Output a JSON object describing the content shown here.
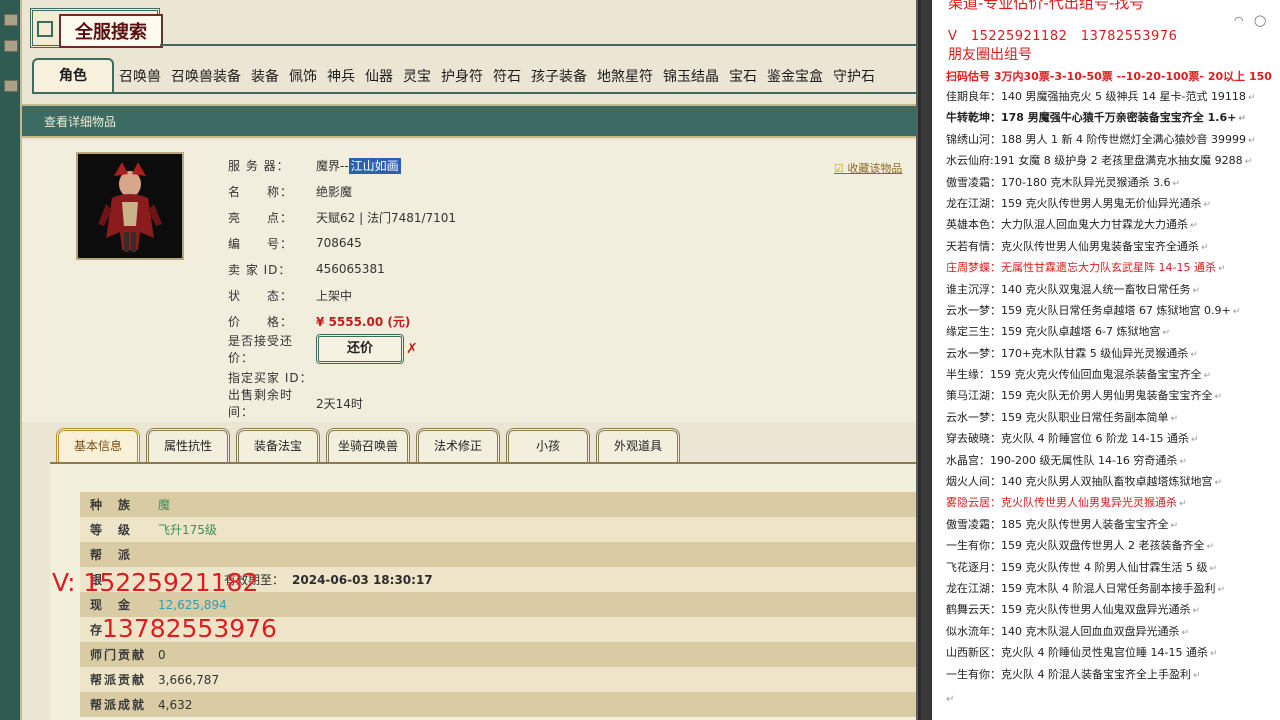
{
  "window": {
    "title": "全服搜索"
  },
  "categories": [
    "角色",
    "召唤兽",
    "召唤兽装备",
    "装备",
    "佩饰",
    "神兵",
    "仙器",
    "灵宝",
    "护身符",
    "符石",
    "孩子装备",
    "地煞星符",
    "锦玉结晶",
    "宝石",
    "鉴金宝盒",
    "守护石"
  ],
  "detail_bar": {
    "label": "查看详细物品"
  },
  "item": {
    "fields": [
      {
        "label": "服 务 器：",
        "value_prefix": "魔界--",
        "value_highlight": "江山如画"
      },
      {
        "label": "名　　称：",
        "value": "绝影魔"
      },
      {
        "label": "亮　　点：",
        "value": "天赋62 | 法门7481/7101"
      },
      {
        "label": "编　　号：",
        "value": "708645"
      },
      {
        "label": "卖 家 ID：",
        "value": "456065381"
      },
      {
        "label": "状　　态：",
        "value": "上架中"
      },
      {
        "label": "价　　格：",
        "value": "¥ 5555.00 (元)"
      },
      {
        "label": "是否接受还价：",
        "value": "还价"
      },
      {
        "label": "指定买家 ID：",
        "value": ""
      },
      {
        "label": "出售剩余时间：",
        "value": "2天14时"
      }
    ],
    "fav_link": "收藏该物品"
  },
  "sub_tabs": [
    "基本信息",
    "属性抗性",
    "装备法宝",
    "坐骑召唤兽",
    "法术修正",
    "小孩",
    "外观道具"
  ],
  "stats": [
    {
      "label": "种　族",
      "value": "魔",
      "style": "green"
    },
    {
      "label": "等　级",
      "value": "飞升175级",
      "style": "green"
    },
    {
      "label": "帮　派",
      "value": "",
      "style": ""
    },
    {
      "label": "银",
      "value": "",
      "style": "",
      "extra_label": "有效期至：",
      "extra_value": "2024-06-03 18:30:17"
    },
    {
      "label": "现　金",
      "value": "12,625,894",
      "style": "cyan"
    },
    {
      "label": "存",
      "value": "",
      "style": ""
    },
    {
      "label": "师门贡献",
      "value": "0",
      "style": ""
    },
    {
      "label": "帮派贡献",
      "value": "3,666,787",
      "style": ""
    },
    {
      "label": "帮派成就",
      "value": "4,632",
      "style": ""
    }
  ],
  "watermark": {
    "line1": "V: 15225921182",
    "line2": "13782553976"
  },
  "doc": {
    "title": "渠道-专业估价-代出组号-找号",
    "phone": "V　15225921182　13782553976",
    "circle": "朋友圈出组号",
    "price_line": "扫码估号 3万内30票-3-10-50票 --10-20-100票- 20以上 150",
    "lines": [
      {
        "text": "佳期良年：140 男魔强抽克火 5 级神兵 14 星卡-范式 19118",
        "style": ""
      },
      {
        "text": "牛转乾坤：178 男魔强牛心猿千万亲密装备宝宝齐全 1.6+",
        "style": "bold"
      },
      {
        "text": "锦绣山河：188 男人 1 新 4 阶传世燃灯全满心猿妙音 39999",
        "style": ""
      },
      {
        "text": "水云仙府:191 女魔 8 级护身 2 老孩里盘满克水抽女魔 9288",
        "style": ""
      },
      {
        "text": "傲雪凌霜：170-180 克木队异光灵猴通杀 3.6",
        "style": ""
      },
      {
        "text": "龙在江湖：159 克火队传世男人男鬼无价仙异光通杀",
        "style": ""
      },
      {
        "text": "英雄本色：大力队混人回血鬼大力甘霖龙大力通杀",
        "style": ""
      },
      {
        "text": "天若有情：克火队传世男人仙男鬼装备宝宝齐全通杀",
        "style": ""
      },
      {
        "text": "庄周梦蝶：无属性甘霖遗忘大力队玄武星阵 14-15 通杀",
        "style": "red"
      },
      {
        "text": "谁主沉浮：140 克火队双鬼混人统一畜牧日常任务",
        "style": ""
      },
      {
        "text": "云水一梦：159 克火队日常任务卓越塔 67 炼狱地宫 0.9+",
        "style": ""
      },
      {
        "text": "缘定三生：159 克火队卓越塔 6-7 炼狱地宫",
        "style": ""
      },
      {
        "text": "云水一梦：170+克木队甘霖 5 级仙异光灵猴通杀",
        "style": ""
      },
      {
        "text": "半生缘：159 克火克火传仙回血鬼混杀装备宝宝齐全",
        "style": ""
      },
      {
        "text": "策马江湖：159 克火队无价男人男仙男鬼装备宝宝齐全",
        "style": ""
      },
      {
        "text": "云水一梦：159 克火队职业日常任务副本简单",
        "style": ""
      },
      {
        "text": "穿去破晓：克火队 4 阶睡宫位 6 阶龙 14-15 通杀",
        "style": ""
      },
      {
        "text": "水晶宫：190-200 级无属性队 14-16 穷奇通杀",
        "style": ""
      },
      {
        "text": "烟火人间：140 克火队男人双抽队畜牧卓越塔炼狱地宫",
        "style": ""
      },
      {
        "text": "雾隐云居：克火队传世男人仙男鬼异光灵猴通杀",
        "style": "red"
      },
      {
        "text": "傲雪凌霜：185 克火队传世男人装备宝宝齐全",
        "style": ""
      },
      {
        "text": "一生有你：159 克火队双盘传世男人 2 老孩装备齐全",
        "style": ""
      },
      {
        "text": "飞花逐月：159 克火队传世 4 阶男人仙甘霖生活 5 级",
        "style": ""
      },
      {
        "text": "龙在江湖：159 克木队 4 阶混人日常任务副本接手盈利",
        "style": ""
      },
      {
        "text": "鹤舞云天：159 克火队传世男人仙鬼双盘异光通杀",
        "style": ""
      },
      {
        "text": "似水流年：140 克木队混人回血血双盘异光通杀",
        "style": ""
      },
      {
        "text": "山西新区：克火队 4 阶睡仙灵性鬼宫位睡 14-15 通杀",
        "style": ""
      },
      {
        "text": "一生有你：克火队 4 阶混人装备宝宝齐全上手盈利",
        "style": ""
      }
    ]
  },
  "colors": {
    "accent": "#3f6a60",
    "price": "#c21c1c",
    "watermark": "#e01b1b"
  }
}
